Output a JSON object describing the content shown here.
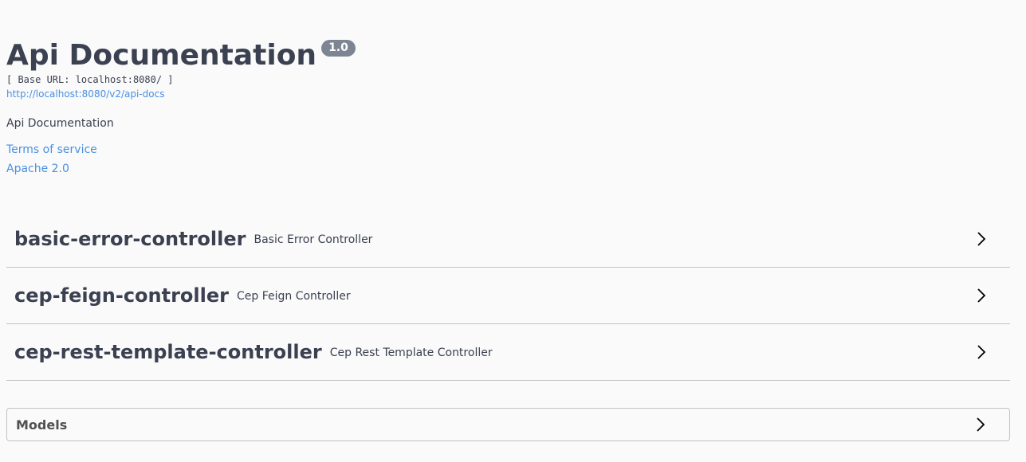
{
  "info": {
    "title": "Api Documentation",
    "version": "1.0",
    "base_url": "[ Base URL: localhost:8080/ ]",
    "spec_link": "http://localhost:8080/v2/api-docs",
    "description": "Api Documentation",
    "terms_link": "Terms of service",
    "license_link": "Apache 2.0"
  },
  "tags": [
    {
      "name": "basic-error-controller",
      "description": "Basic Error Controller"
    },
    {
      "name": "cep-feign-controller",
      "description": "Cep Feign Controller"
    },
    {
      "name": "cep-rest-template-controller",
      "description": "Cep Rest Template Controller"
    }
  ],
  "models": {
    "label": "Models"
  },
  "icons": {
    "expand": "chevron-right-icon"
  },
  "colors": {
    "text": "#3b4151",
    "link": "#4990e2",
    "version_badge": "#7d8492",
    "background": "#fafafa"
  }
}
